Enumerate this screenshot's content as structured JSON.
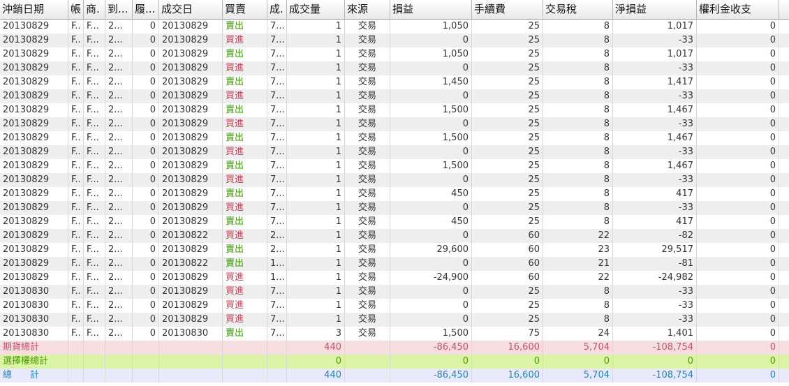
{
  "columns": [
    {
      "key": "settle",
      "label": "沖銷日期",
      "w": 98,
      "align": "l"
    },
    {
      "key": "acct",
      "label": "帳號",
      "w": 22,
      "align": "l"
    },
    {
      "key": "prod",
      "label": "商品",
      "w": 31,
      "align": "l"
    },
    {
      "key": "exp",
      "label": "到期",
      "w": 39,
      "align": "l"
    },
    {
      "key": "strike",
      "label": "履約價",
      "w": 38,
      "align": "r"
    },
    {
      "key": "tdate",
      "label": "成交日",
      "w": 91,
      "align": "l"
    },
    {
      "key": "bs",
      "label": "買賣",
      "w": 64,
      "align": "l"
    },
    {
      "key": "price",
      "label": "成交價",
      "w": 28,
      "align": "l"
    },
    {
      "key": "qty",
      "label": "成交量",
      "w": 83,
      "align": "r"
    },
    {
      "key": "source",
      "label": "來源",
      "w": 65,
      "align": "c"
    },
    {
      "key": "pl",
      "label": "損益",
      "w": 117,
      "align": "r"
    },
    {
      "key": "fee",
      "label": "手續費",
      "w": 102,
      "align": "r"
    },
    {
      "key": "tax",
      "label": "交易稅",
      "w": 100,
      "align": "r"
    },
    {
      "key": "net",
      "label": "淨損益",
      "w": 120,
      "align": "r"
    },
    {
      "key": "prem",
      "label": "權利金收支",
      "w": 118,
      "align": "r"
    }
  ],
  "header_display": [
    "沖銷日期",
    "帳",
    "商.",
    "到...",
    "履...",
    "成交日",
    "買賣",
    "成.",
    "成交量",
    "來源",
    "損益",
    "手續費",
    "交易稅",
    "淨損益",
    "權利金收支"
  ],
  "rows": [
    [
      "20130829",
      "F..",
      "F...",
      "2...",
      "0",
      "20130829",
      "賣出",
      "7...",
      "1",
      "交易",
      "1,050",
      "25",
      "8",
      "1,017",
      "0"
    ],
    [
      "20130829",
      "F..",
      "F...",
      "2...",
      "0",
      "20130829",
      "買進",
      "7...",
      "1",
      "交易",
      "0",
      "25",
      "8",
      "-33",
      "0"
    ],
    [
      "20130829",
      "F..",
      "F...",
      "2...",
      "0",
      "20130829",
      "賣出",
      "7...",
      "1",
      "交易",
      "1,050",
      "25",
      "8",
      "1,017",
      "0"
    ],
    [
      "20130829",
      "F..",
      "F...",
      "2...",
      "0",
      "20130829",
      "買進",
      "7...",
      "1",
      "交易",
      "0",
      "25",
      "8",
      "-33",
      "0"
    ],
    [
      "20130829",
      "F..",
      "F...",
      "2...",
      "0",
      "20130829",
      "賣出",
      "7...",
      "1",
      "交易",
      "1,450",
      "25",
      "8",
      "1,417",
      "0"
    ],
    [
      "20130829",
      "F..",
      "F...",
      "2...",
      "0",
      "20130829",
      "買進",
      "7...",
      "1",
      "交易",
      "0",
      "25",
      "8",
      "-33",
      "0"
    ],
    [
      "20130829",
      "F..",
      "F...",
      "2...",
      "0",
      "20130829",
      "賣出",
      "7...",
      "1",
      "交易",
      "1,500",
      "25",
      "8",
      "1,467",
      "0"
    ],
    [
      "20130829",
      "F..",
      "F...",
      "2...",
      "0",
      "20130829",
      "買進",
      "7...",
      "1",
      "交易",
      "0",
      "25",
      "8",
      "-33",
      "0"
    ],
    [
      "20130829",
      "F..",
      "F...",
      "2...",
      "0",
      "20130829",
      "賣出",
      "7...",
      "1",
      "交易",
      "1,500",
      "25",
      "8",
      "1,467",
      "0"
    ],
    [
      "20130829",
      "F..",
      "F...",
      "2...",
      "0",
      "20130829",
      "買進",
      "7...",
      "1",
      "交易",
      "0",
      "25",
      "8",
      "-33",
      "0"
    ],
    [
      "20130829",
      "F..",
      "F...",
      "2...",
      "0",
      "20130829",
      "賣出",
      "7...",
      "1",
      "交易",
      "1,500",
      "25",
      "8",
      "1,467",
      "0"
    ],
    [
      "20130829",
      "F..",
      "F...",
      "2...",
      "0",
      "20130829",
      "買進",
      "7...",
      "1",
      "交易",
      "0",
      "25",
      "8",
      "-33",
      "0"
    ],
    [
      "20130829",
      "F..",
      "F...",
      "2...",
      "0",
      "20130829",
      "賣出",
      "7...",
      "1",
      "交易",
      "450",
      "25",
      "8",
      "417",
      "0"
    ],
    [
      "20130829",
      "F..",
      "F...",
      "2...",
      "0",
      "20130829",
      "買進",
      "7...",
      "1",
      "交易",
      "0",
      "25",
      "8",
      "-33",
      "0"
    ],
    [
      "20130829",
      "F..",
      "F...",
      "2...",
      "0",
      "20130829",
      "賣出",
      "7...",
      "1",
      "交易",
      "450",
      "25",
      "8",
      "417",
      "0"
    ],
    [
      "20130829",
      "F..",
      "F...",
      "2...",
      "0",
      "20130822",
      "買進",
      "2...",
      "1",
      "交易",
      "0",
      "60",
      "22",
      "-82",
      "0"
    ],
    [
      "20130829",
      "F..",
      "F...",
      "2...",
      "0",
      "20130829",
      "賣出",
      "2...",
      "1",
      "交易",
      "29,600",
      "60",
      "23",
      "29,517",
      "0"
    ],
    [
      "20130829",
      "F..",
      "F...",
      "2...",
      "0",
      "20130822",
      "賣出",
      "1...",
      "1",
      "交易",
      "0",
      "60",
      "21",
      "-81",
      "0"
    ],
    [
      "20130829",
      "F..",
      "F...",
      "2...",
      "0",
      "20130829",
      "買進",
      "1...",
      "1",
      "交易",
      "-24,900",
      "60",
      "22",
      "-24,982",
      "0"
    ],
    [
      "20130830",
      "F..",
      "F...",
      "2...",
      "0",
      "20130829",
      "買進",
      "7...",
      "1",
      "交易",
      "0",
      "25",
      "8",
      "-33",
      "0"
    ],
    [
      "20130830",
      "F..",
      "F...",
      "2...",
      "0",
      "20130829",
      "買進",
      "7...",
      "1",
      "交易",
      "0",
      "25",
      "8",
      "-33",
      "0"
    ],
    [
      "20130830",
      "F..",
      "F...",
      "2...",
      "0",
      "20130829",
      "買進",
      "7...",
      "1",
      "交易",
      "0",
      "25",
      "8",
      "-33",
      "0"
    ],
    [
      "20130830",
      "F..",
      "F...",
      "2...",
      "0",
      "20130830",
      "賣出",
      "7...",
      "3",
      "交易",
      "1,500",
      "75",
      "24",
      "1,401",
      "0"
    ]
  ],
  "summary": [
    {
      "cls": "fut",
      "label": "期貨總計",
      "qty": "440",
      "pl": "-86,450",
      "fee": "16,600",
      "tax": "5,704",
      "net": "-108,754",
      "prem": "0"
    },
    {
      "cls": "opt",
      "label": "選擇權總計",
      "qty": "0",
      "pl": "0",
      "fee": "0",
      "tax": "0",
      "net": "0",
      "prem": "0"
    },
    {
      "cls": "tot",
      "label": "總　　計",
      "qty": "440",
      "pl": "-86,450",
      "fee": "16,600",
      "tax": "5,704",
      "net": "-108,754",
      "prem": "0"
    }
  ],
  "colors": {
    "sell": "#3a9a00",
    "buy": "#d0405a"
  }
}
